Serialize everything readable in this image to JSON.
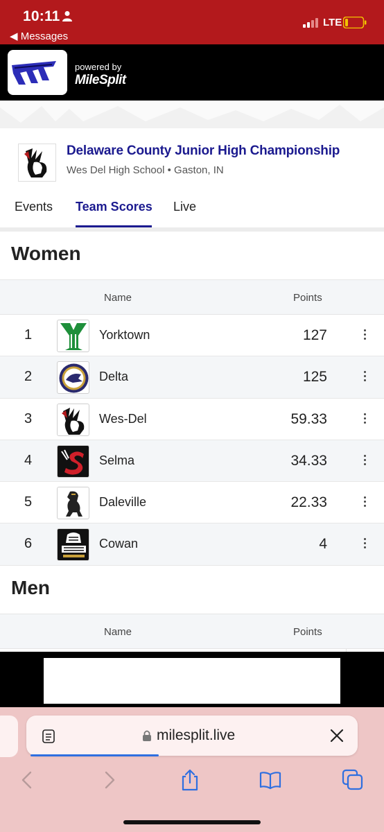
{
  "status_bar": {
    "time": "10:11",
    "back_label": "◀ Messages",
    "network": "LTE"
  },
  "header": {
    "powered_by": "powered by",
    "brand": "MileSplit"
  },
  "meet": {
    "title": "Delaware County Junior High Championship",
    "subtitle": "Wes Del High School • Gaston, IN"
  },
  "tabs": [
    {
      "label": "Events",
      "active": false
    },
    {
      "label": "Team Scores",
      "active": true
    },
    {
      "label": "Live",
      "active": false
    }
  ],
  "women": {
    "heading": "Women",
    "columns": {
      "name": "Name",
      "points": "Points"
    },
    "rows": [
      {
        "rank": "1",
        "team": "Yorktown",
        "points": "127",
        "logo_icon": "yorktown-y-logo"
      },
      {
        "rank": "2",
        "team": "Delta",
        "points": "125",
        "logo_icon": "delta-eagle-logo"
      },
      {
        "rank": "3",
        "team": "Wes-Del",
        "points": "59.33",
        "logo_icon": "wes-del-warrior-logo"
      },
      {
        "rank": "4",
        "team": "Selma",
        "points": "34.33",
        "logo_icon": "selma-s-logo"
      },
      {
        "rank": "5",
        "team": "Daleville",
        "points": "22.33",
        "logo_icon": "daleville-bronco-logo"
      },
      {
        "rank": "6",
        "team": "Cowan",
        "points": "4",
        "logo_icon": "cowan-blackhawks-logo"
      }
    ]
  },
  "men": {
    "heading": "Men",
    "columns": {
      "name": "Name",
      "points": "Points"
    }
  },
  "browser": {
    "url": "milesplit.live"
  },
  "colors": {
    "status_bar": "#b3191c",
    "accent": "#1b1a8f",
    "safari_bg": "#eec6c6"
  }
}
